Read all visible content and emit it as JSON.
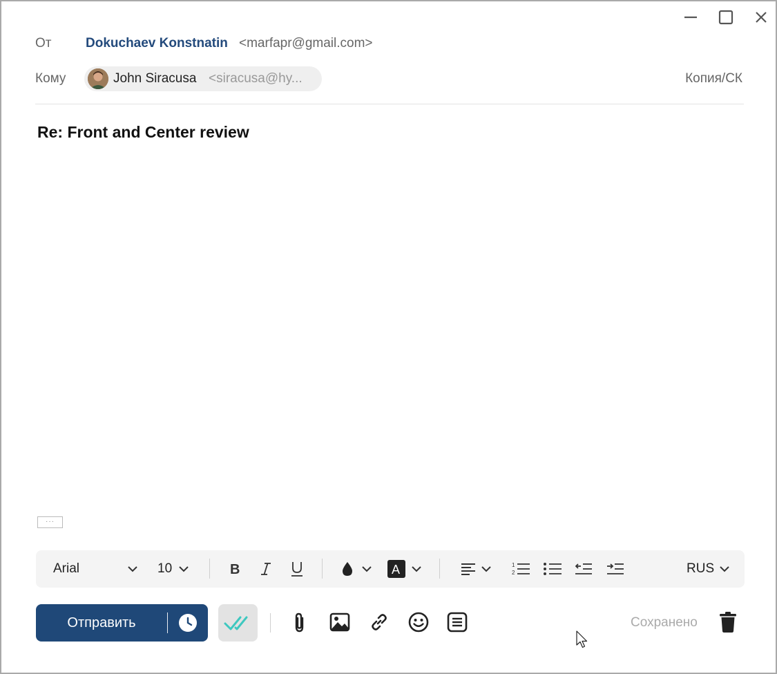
{
  "header": {
    "from_label": "От",
    "from_name": "Dokuchaev Konstnatin",
    "from_email": "<marfapr@gmail.com>",
    "to_label": "Кому",
    "recipient": {
      "name": "John Siracusa",
      "email": "<siracusa@hy..."
    },
    "cc_label": "Копия/СК"
  },
  "subject": "Re: Front and Center review",
  "quote_toggle": "···",
  "format_toolbar": {
    "font_family": "Arial",
    "font_size": "10",
    "language": "RUS",
    "icons": [
      "bold-icon",
      "italic-icon",
      "underline-icon",
      "text-color-icon",
      "highlight-icon",
      "align-left-icon",
      "numbered-list-icon",
      "bullet-list-icon",
      "outdent-icon",
      "indent-icon"
    ]
  },
  "actions": {
    "send_label": "Отправить",
    "saved_status": "Сохранено",
    "icons": [
      "schedule-icon",
      "read-receipt-icon",
      "attach-icon",
      "image-icon",
      "link-icon",
      "emoji-icon",
      "template-icon",
      "trash-icon"
    ]
  },
  "colors": {
    "primary": "#1f4878",
    "sender_name": "#234a7c",
    "receipt_check": "#3ec8c0"
  }
}
